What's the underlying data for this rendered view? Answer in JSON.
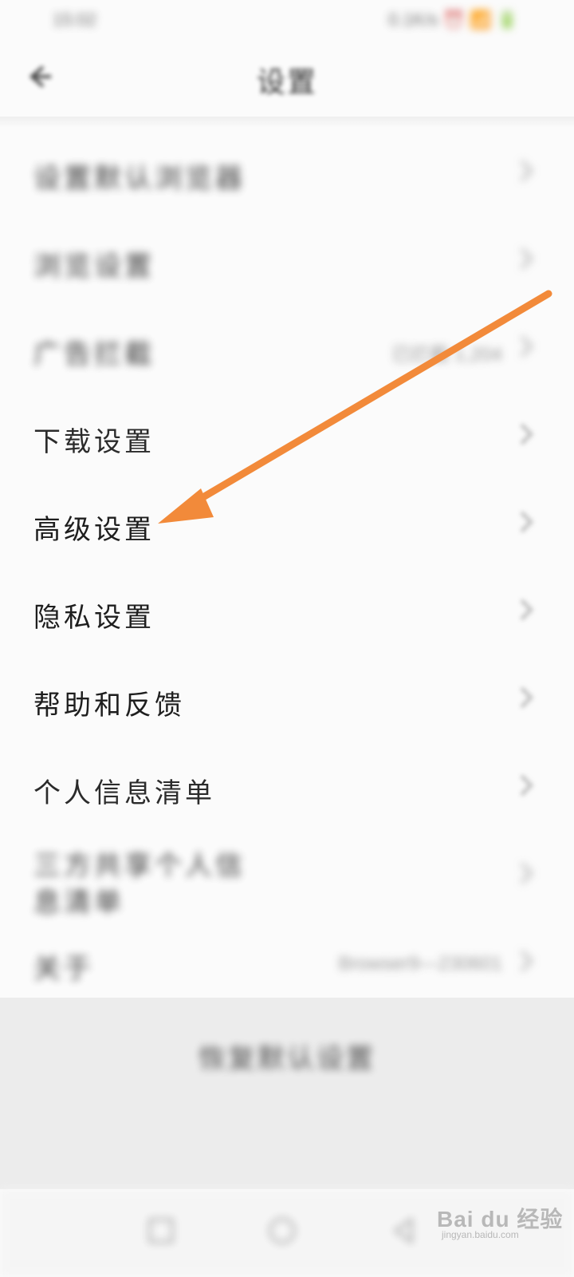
{
  "status_bar": {
    "time": "15:02",
    "icons_text": "0.1K/s ⏰ 📶 🔋"
  },
  "header": {
    "back_icon": "arrow-left-icon",
    "title": "设置"
  },
  "settings": {
    "items": [
      {
        "label": "设置默认浏览器",
        "value": "",
        "blurred": true
      },
      {
        "label": "浏览设置",
        "value": "",
        "blurred": true
      },
      {
        "label": "广告拦截",
        "value": "已拦截 1,204",
        "blurred": true
      },
      {
        "label": "下载设置",
        "value": "",
        "blurred": false
      },
      {
        "label": "高级设置",
        "value": "",
        "blurred": false
      },
      {
        "label": "隐私设置",
        "value": "",
        "blurred": false
      },
      {
        "label": "帮助和反馈",
        "value": "",
        "blurred": false
      },
      {
        "label": "个人信息清单",
        "value": "",
        "blurred": false
      },
      {
        "label": "三方共享个人信息清单",
        "value": "",
        "blurred": true
      },
      {
        "label": "关于",
        "value": "Browser9—230601",
        "blurred": true
      }
    ]
  },
  "bottom": {
    "reset_label": "恢复默认设置"
  },
  "nav_bar": {
    "icons": [
      "square-icon",
      "circle-icon",
      "triangle-back-icon"
    ]
  },
  "annotation": {
    "arrow_color": "#f28a3a"
  },
  "watermark": {
    "logo_text": "Bai du 经验",
    "sub_text": "jingyan.baidu.com"
  },
  "colors": {
    "background": "#fbfbfb",
    "bottom_bar": "#ececec",
    "chevron": "#bdbdbd",
    "text": "#1e1e1e"
  }
}
